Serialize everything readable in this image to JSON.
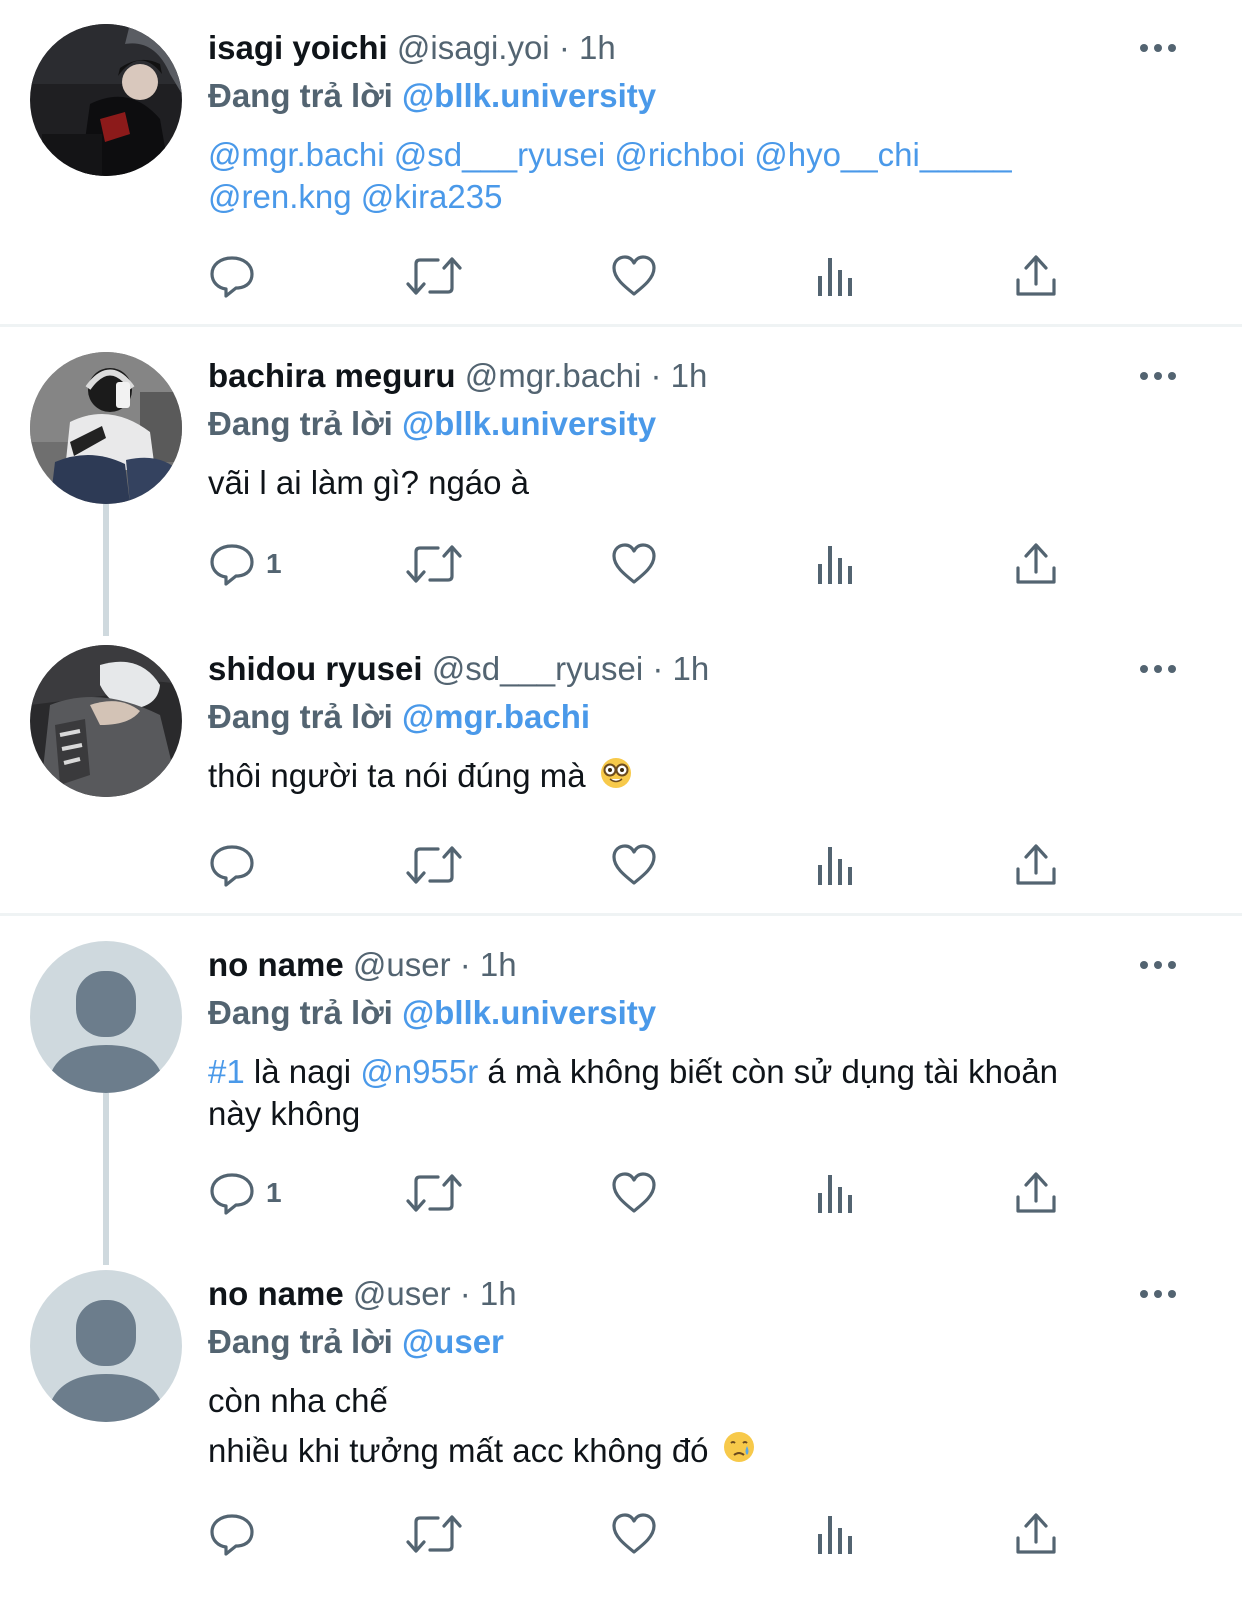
{
  "tweets": [
    {
      "name": "isagi yoichi",
      "handle": "@isagi.yoi",
      "time": "· 1h",
      "reply_prefix": "Đang trả lời",
      "reply_to": "@bllk.university",
      "mentions_line1": "@mgr.bachi @sd___ryusei @richboi @hyo__chi_____",
      "mentions_line2": "@ren.kng @kira235",
      "reply_count": ""
    },
    {
      "name": "bachira meguru",
      "handle": "@mgr.bachi",
      "time": "· 1h",
      "reply_prefix": "Đang trả lời",
      "reply_to": "@bllk.university",
      "text": "vãi l ai làm gì? ngáo à",
      "reply_count": "1"
    },
    {
      "name": "shidou ryusei",
      "handle": "@sd___ryusei",
      "time": "· 1h",
      "reply_prefix": "Đang trả lời",
      "reply_to": "@mgr.bachi",
      "text": "thôi người ta nói đúng mà",
      "emoji": "nerd-face-emoji",
      "reply_count": ""
    },
    {
      "name": "no name",
      "handle": "@user",
      "time": "· 1h",
      "reply_prefix": "Đang trả lời",
      "reply_to": "@bllk.university",
      "hashtag": "#1",
      "text_a": " là nagi ",
      "mention": "@n955r",
      "text_b": " á mà không biết còn sử dụng tài khoản",
      "text_line2": "này không",
      "reply_count": "1"
    },
    {
      "name": "no name",
      "handle": "@user",
      "time": "· 1h",
      "reply_prefix": "Đang trả lời",
      "reply_to": "@user",
      "text_line1": "còn nha chế",
      "text_line2": "nhiều khi tưởng mất acc không đó",
      "emoji": "crying-face-emoji",
      "reply_count": ""
    }
  ],
  "icons": {
    "reply": "reply-icon",
    "retweet": "retweet-icon",
    "like": "like-icon",
    "views": "views-icon",
    "share": "share-icon",
    "more": "more-icon"
  },
  "colors": {
    "link": "#4a99e9",
    "secondary_text": "#536471",
    "primary_text": "#0f1419",
    "divider": "#eff3f4",
    "thread_line": "#cfd9de"
  }
}
